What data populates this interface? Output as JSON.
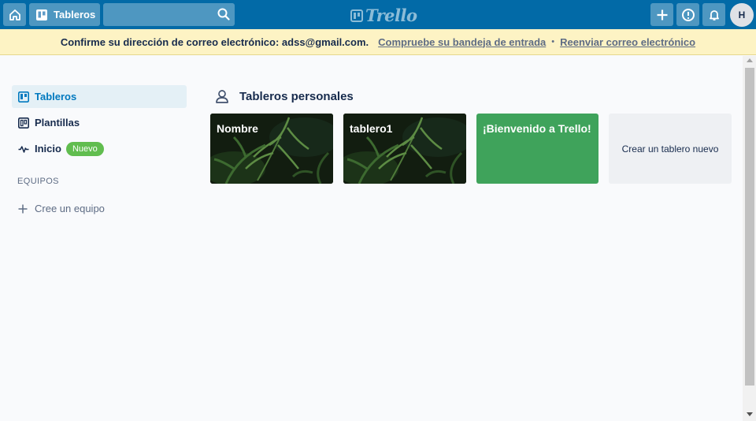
{
  "header": {
    "boards_label": "Tableros",
    "logo_text": "Trello",
    "avatar_initial": "H"
  },
  "banner": {
    "message": "Confirme su dirección de correo electrónico: adss@gmail.com.",
    "check_inbox_link": "Compruebe su bandeja de entrada",
    "separator": "•",
    "resend_link": "Reenviar correo electrónico"
  },
  "sidebar": {
    "items": [
      {
        "label": "Tableros",
        "icon": "board-icon",
        "active": true
      },
      {
        "label": "Plantillas",
        "icon": "template-icon"
      },
      {
        "label": "Inicio",
        "icon": "activity-icon",
        "badge": "Nuevo"
      }
    ],
    "teams_heading": "EQUIPOS",
    "create_team": "Cree un equipo"
  },
  "main": {
    "section_title": "Tableros personales",
    "boards": [
      {
        "name": "Nombre",
        "background": "jungle"
      },
      {
        "name": "tablero1",
        "background": "jungle"
      },
      {
        "name": "¡Bienvenido a Trello!",
        "background": "#3fa35b"
      }
    ],
    "create_board": "Crear un tablero nuevo"
  },
  "colors": {
    "header": "#026aa7",
    "banner": "#fdf3c4",
    "active_sidebar": "#e4f0f6",
    "accent": "#0079bf",
    "badge": "#61bd4f"
  }
}
